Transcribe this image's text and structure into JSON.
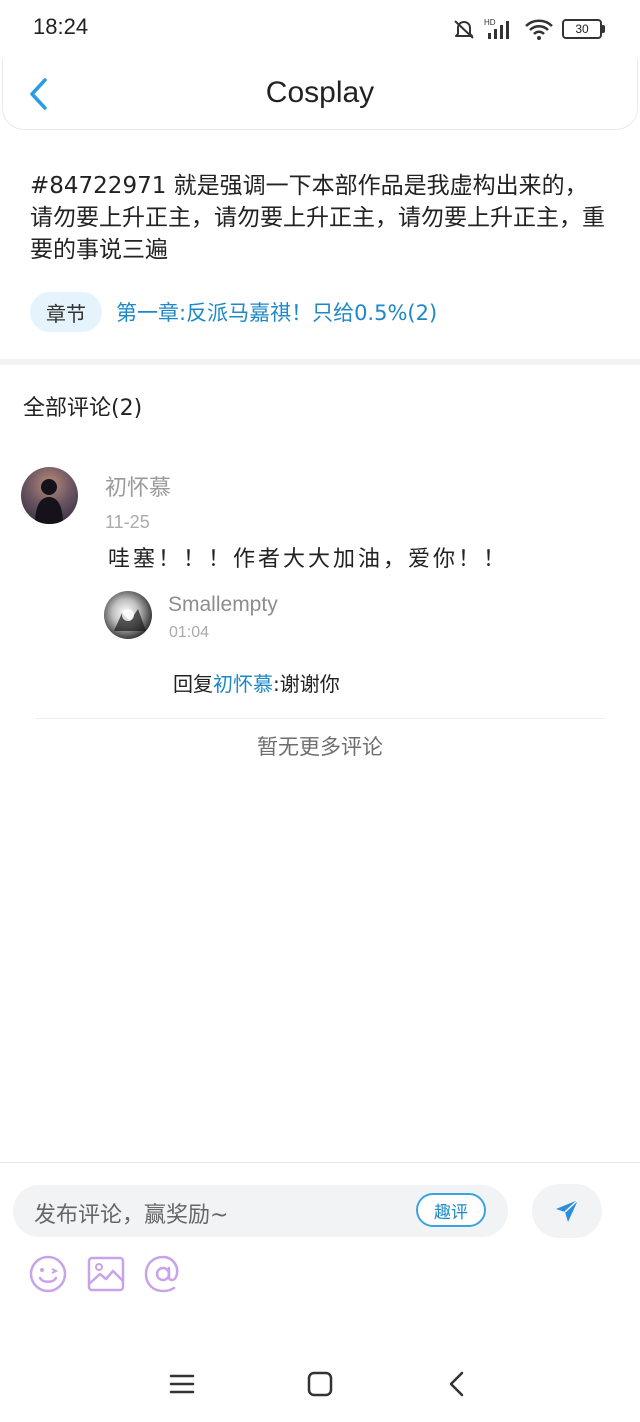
{
  "status_bar": {
    "time": "18:24",
    "battery": "30",
    "icons": [
      "mute-icon",
      "hd-icon",
      "signal-icon",
      "wifi-icon",
      "battery-icon"
    ]
  },
  "header": {
    "title": "Cosplay",
    "back_icon": "chevron-left-icon"
  },
  "post": {
    "text": "#84722971 就是强调一下本部作品是我虚构出来的，请勿要上升正主，请勿要上升正主，请勿要上升正主，重要的事说三遍",
    "chapter_label": "章节",
    "chapter_link": "第一章:反派马嘉祺！只给0.5%(2)"
  },
  "comments": {
    "title": "全部评论(2)",
    "items": [
      {
        "name": "初怀慕",
        "date": "11-25",
        "text": "哇塞！！！作者大大加油，爱你！！",
        "replies": [
          {
            "name": "Smallempty",
            "date": "01:04",
            "prefix": "回复",
            "mention": "初怀慕",
            "suffix": ":谢谢你"
          }
        ]
      }
    ],
    "no_more": "暂无更多评论"
  },
  "input_bar": {
    "placeholder": "发布评论，赢奖励~",
    "badge": "趣评",
    "tools": [
      "emoji-icon",
      "image-icon",
      "at-icon"
    ]
  },
  "colors": {
    "accent": "#1e88c7",
    "badge_bg": "#e5f3fc",
    "tool_icon": "#c9a3e8",
    "send_icon": "#2b8ee0"
  }
}
